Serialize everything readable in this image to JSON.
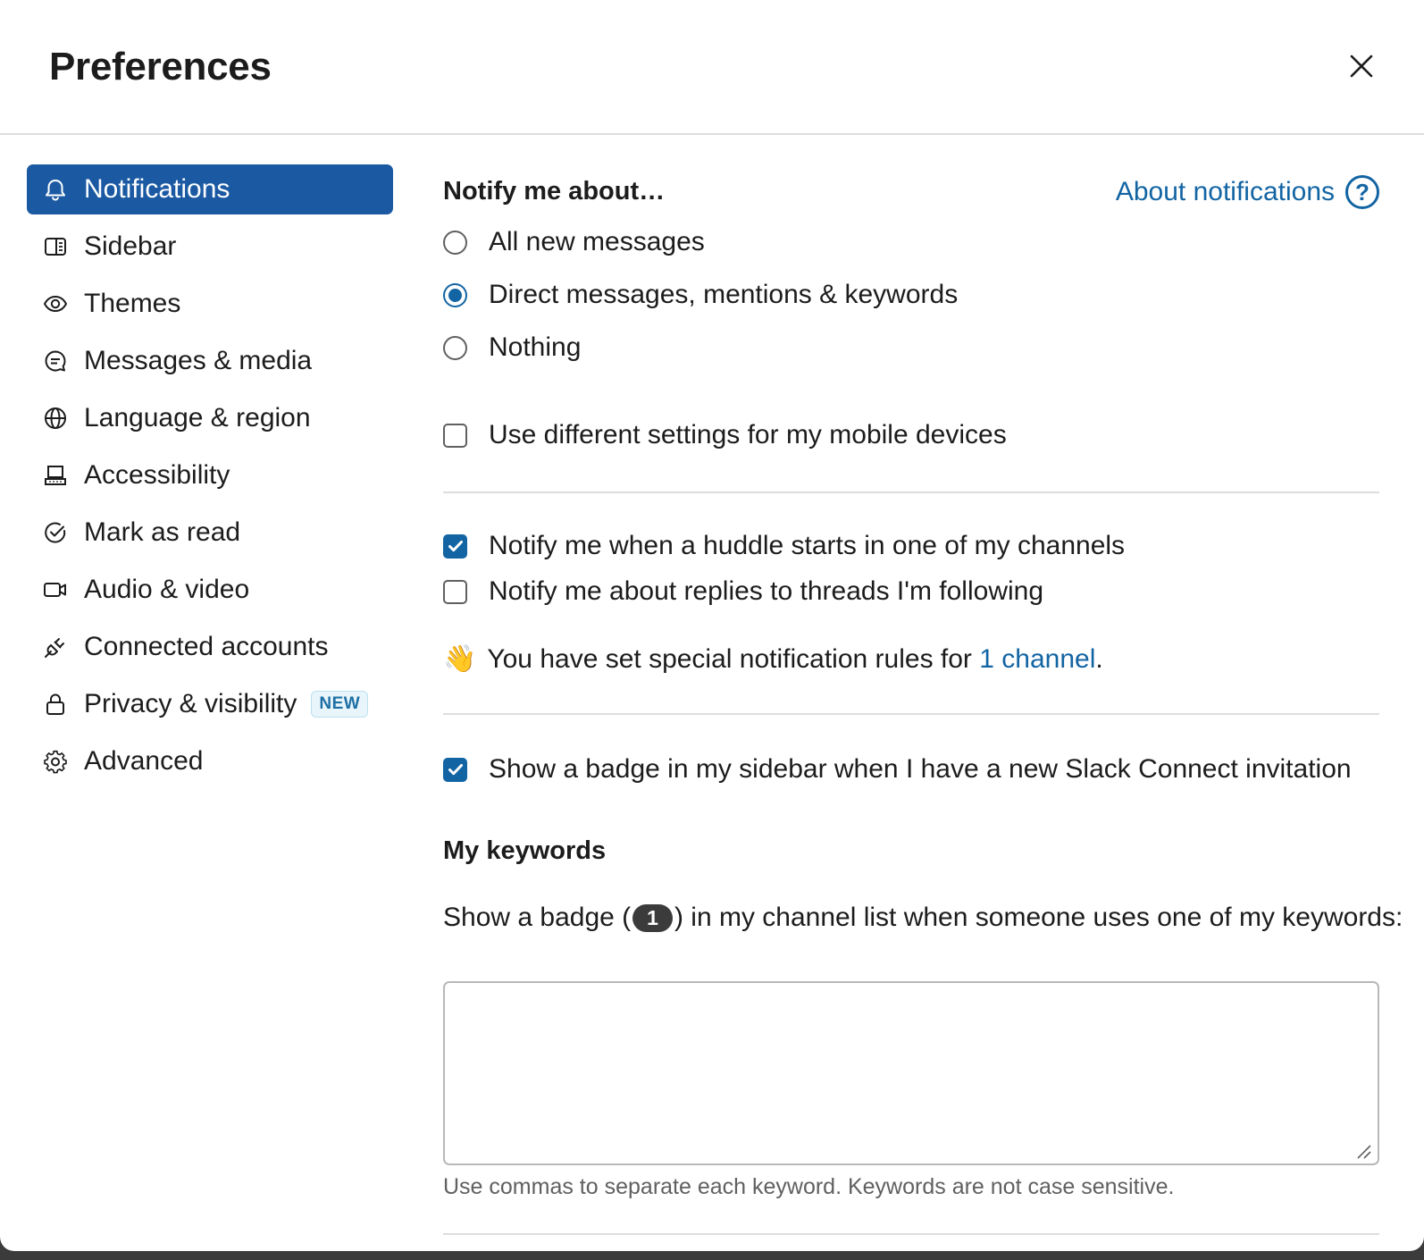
{
  "header": {
    "title": "Preferences",
    "close_icon": "close-icon"
  },
  "sidebar": {
    "items": [
      {
        "label": "Notifications",
        "icon": "bell-icon",
        "active": true
      },
      {
        "label": "Sidebar",
        "icon": "sidebar-icon"
      },
      {
        "label": "Themes",
        "icon": "eye-icon"
      },
      {
        "label": "Messages & media",
        "icon": "message-icon"
      },
      {
        "label": "Language & region",
        "icon": "globe-icon"
      },
      {
        "label": "Accessibility",
        "icon": "keyboard-icon"
      },
      {
        "label": "Mark as read",
        "icon": "check-circle-icon"
      },
      {
        "label": "Audio & video",
        "icon": "video-icon"
      },
      {
        "label": "Connected accounts",
        "icon": "plug-icon"
      },
      {
        "label": "Privacy & visibility",
        "icon": "lock-icon",
        "badge": "NEW"
      },
      {
        "label": "Advanced",
        "icon": "gear-icon"
      }
    ]
  },
  "notify": {
    "heading": "Notify me about…",
    "about_link": "About notifications",
    "about_icon": "help-icon",
    "options": [
      {
        "label": "All new messages",
        "selected": false
      },
      {
        "label": "Direct messages, mentions & keywords",
        "selected": true
      },
      {
        "label": "Nothing",
        "selected": false
      }
    ],
    "mobile_checkbox": {
      "label": "Use different settings for my mobile devices",
      "checked": false
    }
  },
  "huddle": {
    "huddle_checkbox": {
      "label": "Notify me when a huddle starts in one of my channels",
      "checked": true
    },
    "threads_checkbox": {
      "label": "Notify me about replies to threads I'm following",
      "checked": false
    },
    "special_rules_emoji": "👋",
    "special_rules_prefix": "You have set special notification rules for ",
    "special_rules_link": "1 channel",
    "special_rules_suffix": "."
  },
  "connect": {
    "badge_checkbox": {
      "label": "Show a badge in my sidebar when I have a new Slack Connect invitation",
      "checked": true
    }
  },
  "keywords": {
    "heading": "My keywords",
    "desc_prefix": "Show a badge (",
    "badge_count": "1",
    "desc_suffix": ") in my channel list when someone uses one of my keywords:",
    "value": "",
    "hint": "Use commas to separate each keyword. Keywords are not case sensitive."
  },
  "colors": {
    "accent": "#1264a3",
    "active_nav": "#1b5aa3",
    "badge_pill": "#3b3b3c"
  }
}
